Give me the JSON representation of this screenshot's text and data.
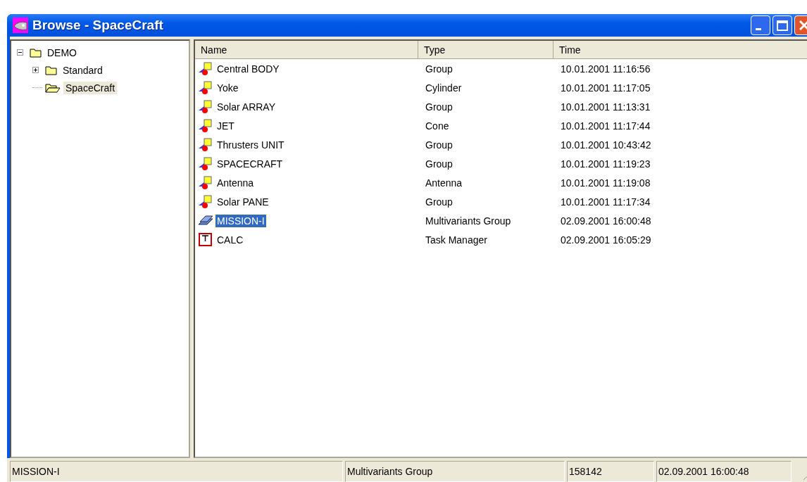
{
  "window": {
    "title": "Browse - SpaceCraft"
  },
  "tree": [
    {
      "label": "DEMO",
      "expanded": true,
      "selected": false,
      "children": [
        {
          "label": "Standard",
          "expanded": false,
          "selected": false
        },
        {
          "label": "SpaceCraft",
          "selected": true
        }
      ]
    }
  ],
  "table": {
    "columns": [
      "Name",
      "Type",
      "Time"
    ],
    "rows": [
      {
        "kind": "object",
        "name": "Central BODY",
        "type": "Group",
        "time": "10.01.2001 11:16:56",
        "selected": false
      },
      {
        "kind": "object",
        "name": "Yoke",
        "type": "Cylinder",
        "time": "10.01.2001 11:17:05",
        "selected": false
      },
      {
        "kind": "object",
        "name": "Solar ARRAY",
        "type": "Group",
        "time": "10.01.2001 11:13:31",
        "selected": false
      },
      {
        "kind": "object",
        "name": "JET",
        "type": "Cone",
        "time": "10.01.2001 11:17:44",
        "selected": false
      },
      {
        "kind": "object",
        "name": "Thrusters UNIT",
        "type": "Group",
        "time": "10.01.2001 10:43:42",
        "selected": false
      },
      {
        "kind": "object",
        "name": "SPACECRAFT",
        "type": "Group",
        "time": "10.01.2001 11:19:23",
        "selected": false
      },
      {
        "kind": "object",
        "name": "Antenna",
        "type": "Antenna",
        "time": "10.01.2001 11:19:08",
        "selected": false
      },
      {
        "kind": "object",
        "name": "Solar PANE",
        "type": "Group",
        "time": "10.01.2001 11:17:34",
        "selected": false
      },
      {
        "kind": "multivariant",
        "name": "MISSION-I",
        "type": "Multivariants Group",
        "time": "02.09.2001 16:00:48",
        "selected": true
      },
      {
        "kind": "task",
        "name": "CALC",
        "type": "Task Manager",
        "time": "02.09.2001 16:05:29",
        "selected": false
      }
    ]
  },
  "status_bar": [
    "MISSION-I",
    "Multivariants Group",
    "158142",
    "02.09.2001 16:00:48"
  ]
}
